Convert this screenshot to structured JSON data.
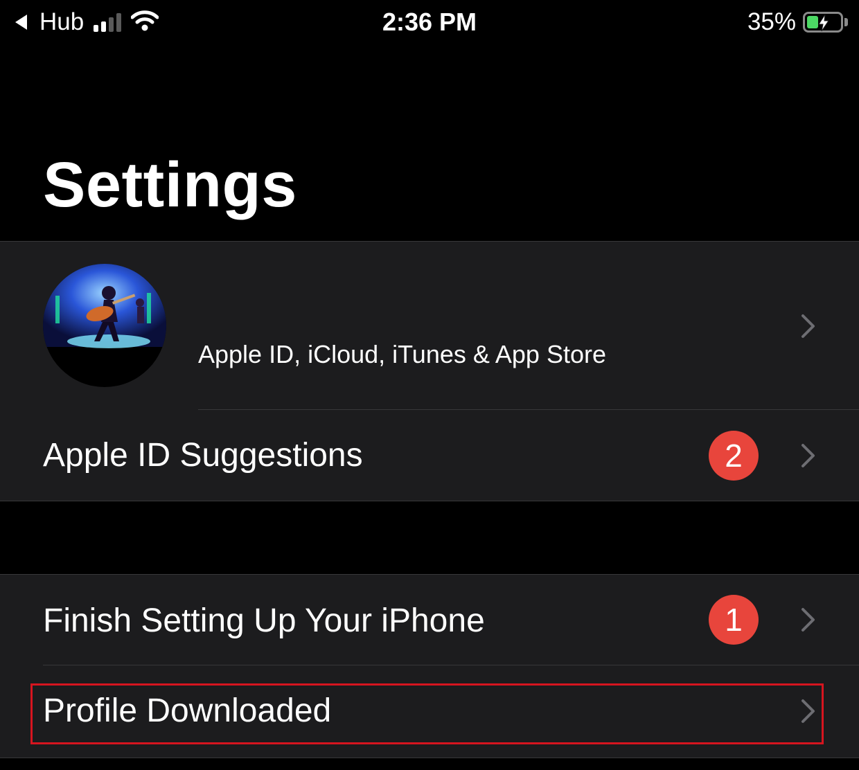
{
  "status_bar": {
    "back_app": "Hub",
    "time": "2:36 PM",
    "battery_percent": "35%",
    "battery_level": 0.35,
    "charging": true,
    "signal_bars_active": 2,
    "signal_bars_total": 4
  },
  "page": {
    "title": "Settings"
  },
  "account": {
    "subtitle": "Apple ID, iCloud, iTunes & App Store"
  },
  "rows": {
    "suggestions": {
      "label": "Apple ID Suggestions",
      "badge": "2"
    },
    "finish_setup": {
      "label": "Finish Setting Up Your iPhone",
      "badge": "1"
    },
    "profile": {
      "label": "Profile Downloaded"
    }
  },
  "colors": {
    "background": "#000000",
    "group_background": "#1c1c1e",
    "separator": "#38383a",
    "badge": "#e8453c",
    "chevron": "#6d6d72",
    "battery_fill": "#4cd964",
    "highlight_border": "#d6151f"
  },
  "icons": [
    "back-arrow-icon",
    "cellular-signal-icon",
    "wifi-icon",
    "battery-charging-icon",
    "chevron-right-icon"
  ]
}
